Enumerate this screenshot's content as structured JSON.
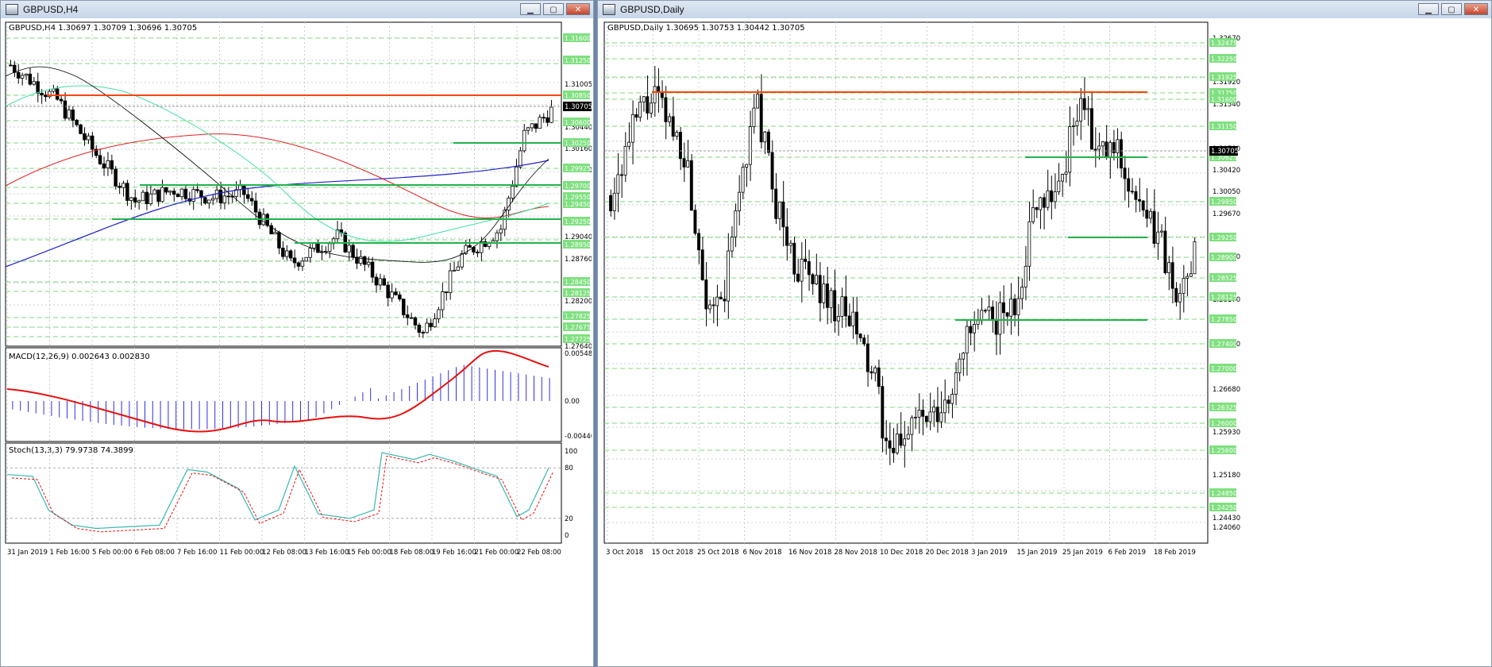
{
  "left_window": {
    "title": "GBPUSD,H4",
    "chart_header": "GBPUSD,H4  1.30697 1.30709 1.30696 1.30705",
    "price_axis": [
      "1.31005",
      "1.30440",
      "1.30160",
      "1.29880",
      "1.29040",
      "1.28760",
      "1.28200",
      "1.27640"
    ],
    "level_labels": [
      "1.31600",
      "1.31250",
      "1.30850",
      "1.30600",
      "1.30250",
      "1.29925",
      "1.29700",
      "1.29550",
      "1.29450",
      "1.29250",
      "1.28950",
      "1.28450",
      "1.28125",
      "1.27825",
      "1.27675",
      "1.27725"
    ],
    "current_price": "1.30705",
    "macd_label": "MACD(12,26,9) 0.002643 0.002830",
    "macd_axis": [
      "0.005482",
      "0.00",
      "-0.004467"
    ],
    "stoch_label": "Stoch(13,3,3) 79.9738 74.3899",
    "stoch_axis": [
      "100",
      "80",
      "20",
      "0"
    ],
    "time_axis": [
      "31 Jan 2019",
      "1 Feb 16:00",
      "5 Feb 00:00",
      "6 Feb 08:00",
      "7 Feb 16:00",
      "11 Feb 00:00",
      "12 Feb 08:00",
      "13 Feb 16:00",
      "15 Feb 00:00",
      "18 Feb 08:00",
      "19 Feb 16:00",
      "21 Feb 00:00",
      "22 Feb 08:00"
    ]
  },
  "right_window": {
    "title": "GBPUSD,Daily",
    "chart_header": "GBPUSD,Daily  1.30695 1.30753 1.30442 1.30705",
    "price_axis": [
      "1.32670",
      "1.31920",
      "1.31540",
      "1.30790",
      "1.30420",
      "1.30050",
      "1.29670",
      "1.28920",
      "1.28170",
      "1.27400",
      "1.26680",
      "1.25930",
      "1.25180",
      "1.24430",
      "1.24060"
    ],
    "level_labels": [
      "1.32475",
      "1.32250",
      "1.31925",
      "1.31750",
      "1.31600",
      "1.31150",
      "1.30625",
      "1.29850",
      "1.29250",
      "1.28900",
      "1.28525",
      "1.28125",
      "1.27850",
      "1.27400",
      "1.27000",
      "1.26325",
      "1.26000",
      "1.25600",
      "1.24850",
      "1.24250"
    ],
    "current_price": "1.30705",
    "time_axis": [
      "3 Oct 2018",
      "15 Oct 2018",
      "25 Oct 2018",
      "6 Nov 2018",
      "16 Nov 2018",
      "28 Nov 2018",
      "10 Dec 2018",
      "20 Dec 2018",
      "3 Jan 2019",
      "15 Jan 2019",
      "25 Jan 2019",
      "6 Feb 2019",
      "18 Feb 2019"
    ]
  },
  "colors": {
    "bull_green": "#22b14c",
    "red_line": "#ff4500",
    "grid": "#c8ccd4",
    "macd_hist": "#3030e0",
    "macd_signal": "#e81010",
    "stoch_main": "#36b8b0",
    "stoch_signal": "#e81010"
  }
}
